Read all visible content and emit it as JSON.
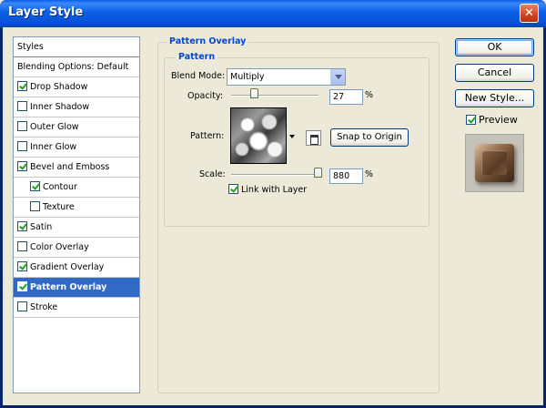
{
  "window": {
    "title": "Layer Style",
    "close_glyph": "✕"
  },
  "styles_list": {
    "items": [
      {
        "label": "Styles",
        "checkbox": false,
        "checked": false,
        "selected": false
      },
      {
        "label": "Blending Options: Default",
        "checkbox": false,
        "checked": false,
        "selected": false
      },
      {
        "label": "Drop Shadow",
        "checkbox": true,
        "checked": true,
        "selected": false
      },
      {
        "label": "Inner Shadow",
        "checkbox": true,
        "checked": false,
        "selected": false
      },
      {
        "label": "Outer Glow",
        "checkbox": true,
        "checked": false,
        "selected": false
      },
      {
        "label": "Inner Glow",
        "checkbox": true,
        "checked": false,
        "selected": false
      },
      {
        "label": "Bevel and Emboss",
        "checkbox": true,
        "checked": true,
        "selected": false
      },
      {
        "label": "Contour",
        "checkbox": true,
        "checked": true,
        "selected": false,
        "indent": true
      },
      {
        "label": "Texture",
        "checkbox": true,
        "checked": false,
        "selected": false,
        "indent": true
      },
      {
        "label": "Satin",
        "checkbox": true,
        "checked": true,
        "selected": false
      },
      {
        "label": "Color Overlay",
        "checkbox": true,
        "checked": false,
        "selected": false
      },
      {
        "label": "Gradient Overlay",
        "checkbox": true,
        "checked": true,
        "selected": false
      },
      {
        "label": "Pattern Overlay",
        "checkbox": true,
        "checked": true,
        "selected": true
      },
      {
        "label": "Stroke",
        "checkbox": true,
        "checked": false,
        "selected": false
      }
    ]
  },
  "pattern_overlay": {
    "group_title": "Pattern Overlay",
    "subgroup_title": "Pattern",
    "blend_mode_label": "Blend Mode:",
    "blend_mode_value": "Multiply",
    "opacity_label": "Opacity:",
    "opacity_value": "27",
    "opacity_percent": 27,
    "percent_sign": "%",
    "pattern_label": "Pattern:",
    "snap_button": "Snap to Origin",
    "scale_label": "Scale:",
    "scale_value": "880",
    "scale_fraction": 1.0,
    "link_label": "Link with Layer",
    "link_checked": true
  },
  "buttons": {
    "ok": "OK",
    "cancel": "Cancel",
    "new_style": "New Style...",
    "preview_label": "Preview",
    "preview_checked": true
  },
  "icons": {
    "pattern_swatch": "pattern-swatch-icon",
    "dropdown": "chevron-down-icon",
    "new_preset": "new-preset-icon",
    "close": "close-icon"
  },
  "colors": {
    "titlebar": "#0A5FE6",
    "selection": "#316AC5",
    "legend_text": "#0046D5",
    "dialog_bg": "#ECE9D8"
  }
}
